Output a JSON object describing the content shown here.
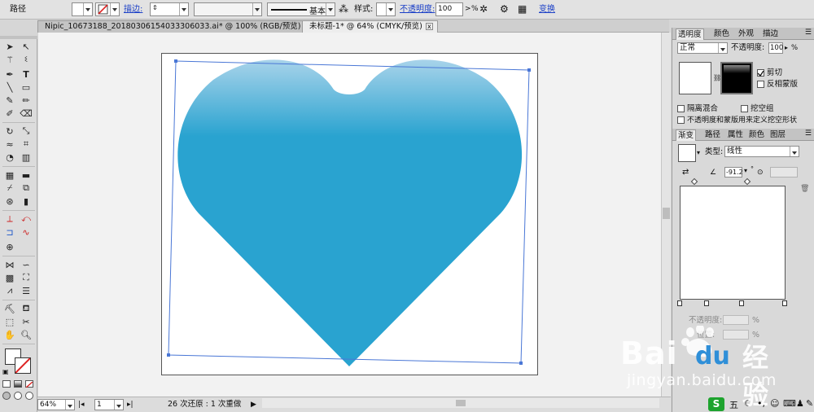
{
  "control_bar": {
    "object_label": "路径",
    "stroke_label": "描边:",
    "brush_label": "基本",
    "style_label": "样式:",
    "opacity_label": "不透明度:",
    "opacity_value": "100",
    "opacity_arrow": ">",
    "opacity_unit": "%",
    "transform_label": "变换"
  },
  "tabs": [
    {
      "label": "Nipic_10673188_20180306154033306033.ai* @ 100% (RGB/预览)",
      "close": "x"
    },
    {
      "label": "未标题-1* @ 64% (CMYK/预览)",
      "close": "x"
    }
  ],
  "status": {
    "zoom": "64%",
    "page": "1",
    "history": "26 次还原 : 1 次重做",
    "play": "▶"
  },
  "panel_top": {
    "tabs": [
      "透明度",
      "颜色",
      "外观",
      "描边"
    ],
    "blend_mode": "正常",
    "opacity_label": "不透明度:",
    "opacity_value": "100",
    "opacity_unit": "%",
    "clip_label": "剪切",
    "invert_mask_label": "反相蒙版",
    "isolate_label": "隔离混合",
    "knockout_label": "挖空组",
    "opacity_mask_label": "不透明度和蒙版用来定义挖空形状"
  },
  "panel_gradient": {
    "tabs": [
      "渐变",
      "路径",
      "属性",
      "颜色",
      "图层"
    ],
    "type_label": "类型:",
    "type_value": "线性",
    "angle_value": "-91.2",
    "angle_unit": "°",
    "opacity_label": "不透明度:",
    "opacity_unit": "%",
    "location_label": "位置:",
    "location_unit": "%"
  },
  "watermark": {
    "text_bai": "Bai",
    "text_du": "du",
    "text_cn": "经验",
    "url": "jingyan.baidu.com"
  },
  "taskbar": {
    "ime_char": "五",
    "ime_s": "S"
  },
  "colors": {
    "heart_top": "#a8d3ea",
    "heart_main": "#29a3d0",
    "selection": "#4a77d6",
    "link": "#1a3fc7"
  }
}
